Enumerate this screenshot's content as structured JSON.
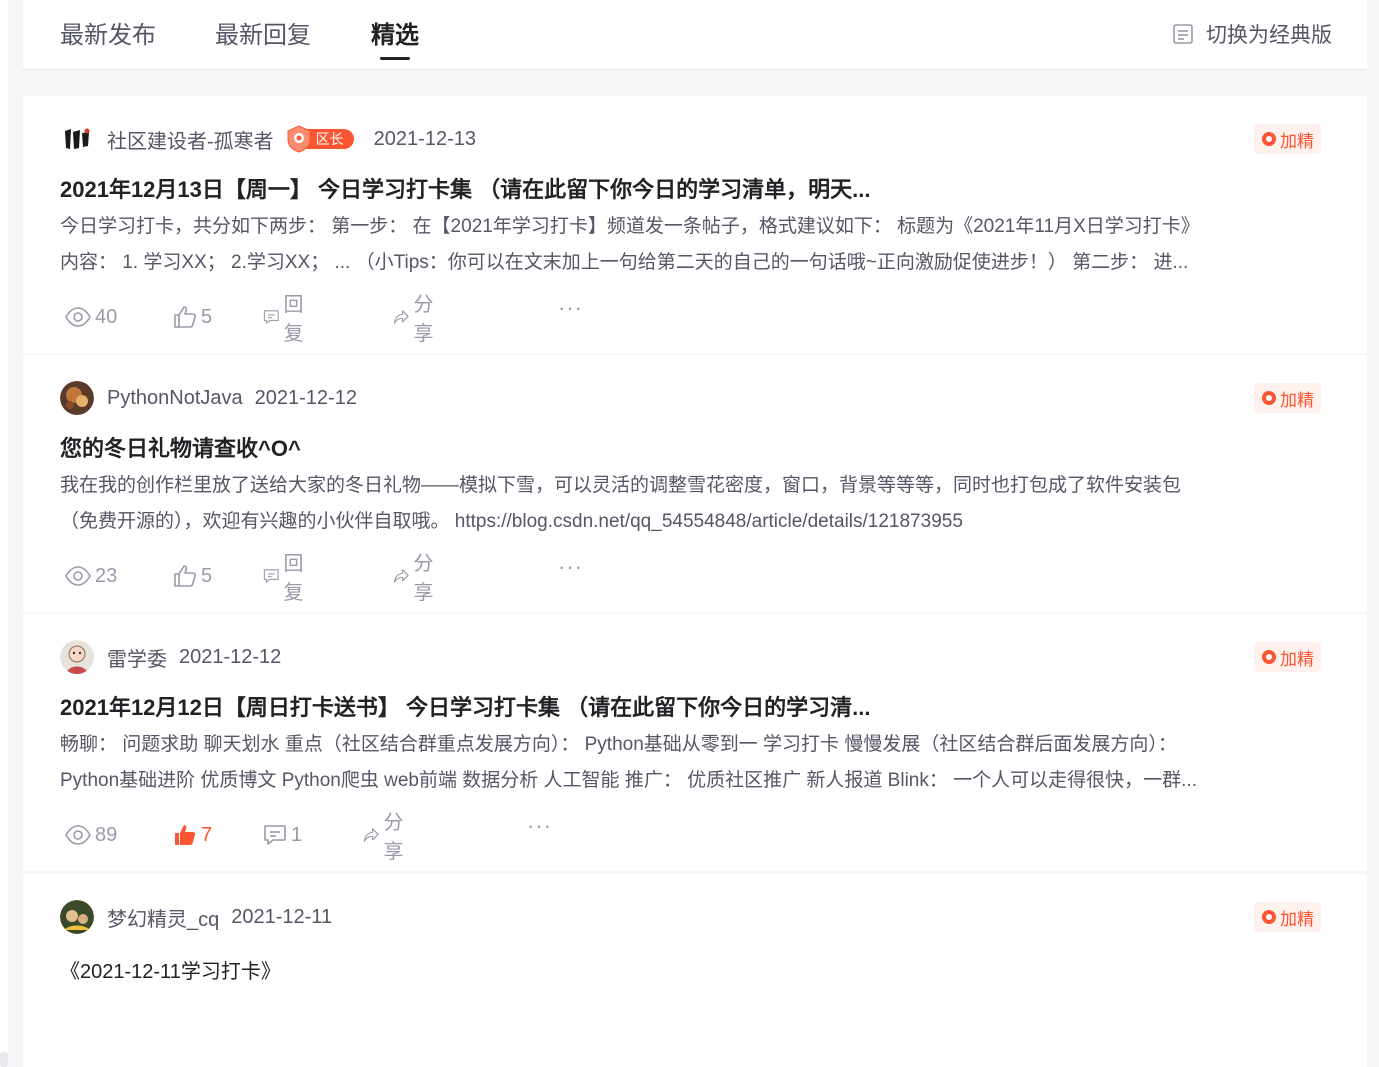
{
  "tabs": [
    {
      "label": "最新发布",
      "active": false
    },
    {
      "label": "最新回复",
      "active": false
    },
    {
      "label": "精选",
      "active": true
    }
  ],
  "switch_label": "切换为经典版",
  "colors": {
    "accent": "#fc5531",
    "text_primary": "#222226",
    "text_secondary": "#555666",
    "text_muted": "#999aaa"
  },
  "feature_label": "加精",
  "actions": {
    "reply": "回复",
    "share": "分享",
    "more": "···"
  },
  "posts": [
    {
      "author": "社区建设者-孤寒者",
      "badge": "区长",
      "date": "2021-12-13",
      "title": "2021年12月13日【周一】 今日学习打卡集 （请在此留下你今日的学习清单，明天...",
      "excerpt": [
        "今日学习打卡，共分如下两步： 第一步： 在【2021年学习打卡】频道发一条帖子，格式建议如下： 标题为《2021年11月X日学习打卡》",
        "内容： 1. 学习XX； 2.学习XX； ... （小Tips：你可以在文末加上一句给第二天的自己的一句话哦~正向激励促使进步！） 第二步： 进..."
      ],
      "views": "40",
      "likes": "5",
      "comments": "回复",
      "liked": false
    },
    {
      "author": "PythonNotJava",
      "date": "2021-12-12",
      "title": "您的冬日礼物请查收^O^",
      "excerpt": [
        "我在我的创作栏里放了送给大家的冬日礼物——模拟下雪，可以灵活的调整雪花密度，窗口，背景等等等，同时也打包成了软件安装包",
        "（免费开源的），欢迎有兴趣的小伙伴自取哦。 https://blog.csdn.net/qq_54554848/article/details/121873955"
      ],
      "views": "23",
      "likes": "5",
      "comments": "回复",
      "liked": false
    },
    {
      "author": "雷学委",
      "date": "2021-12-12",
      "title": "2021年12月12日【周日打卡送书】 今日学习打卡集 （请在此留下你今日的学习清...",
      "excerpt": [
        "畅聊： 问题求助 聊天划水 重点（社区结合群重点发展方向）： Python基础从零到一 学习打卡 慢慢发展（社区结合群后面发展方向）：",
        "Python基础进阶 优质博文 Python爬虫 web前端 数据分析 人工智能 推广： 优质社区推广 新人报道 Blink： 一个人可以走得很快，一群..."
      ],
      "views": "89",
      "likes": "7",
      "comments": "1",
      "liked": true
    },
    {
      "author": "梦幻精灵_cq",
      "date": "2021-12-11",
      "title": "《2021-12-11学习打卡》"
    }
  ]
}
